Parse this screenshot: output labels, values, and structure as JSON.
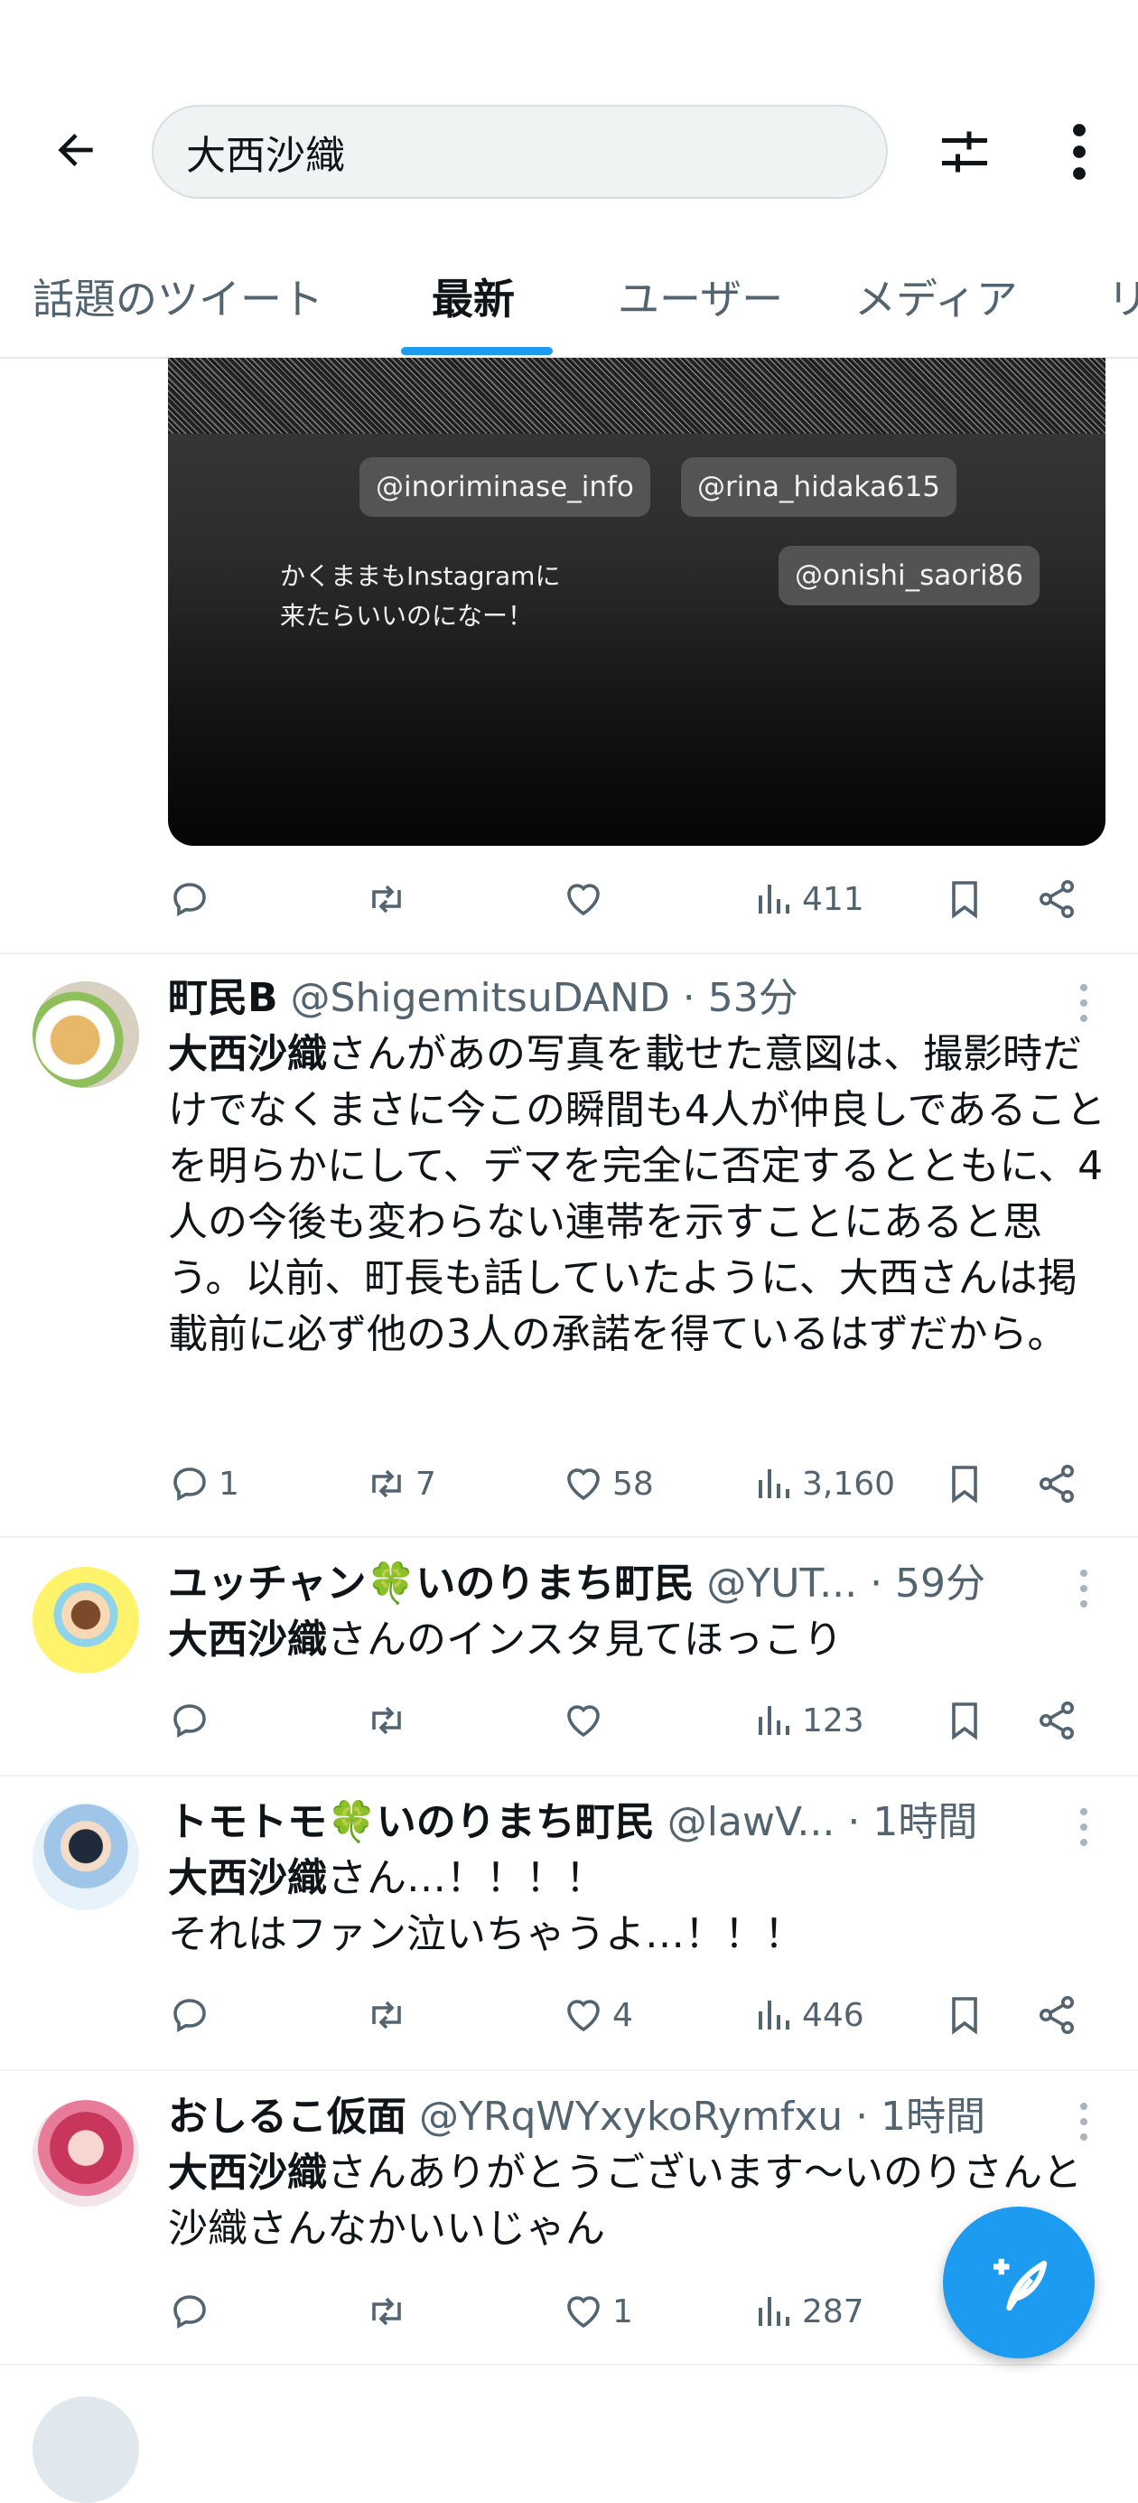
{
  "header": {
    "search_value": "大西沙織",
    "tabs": [
      {
        "label": "話題のツイート"
      },
      {
        "label": "最新"
      },
      {
        "label": "ユーザー"
      },
      {
        "label": "メディア"
      },
      {
        "label": "リ"
      }
    ],
    "active_tab": "最新"
  },
  "media": {
    "tags": [
      "@inoriminase_info",
      "@rina_hidaka615",
      "@onishi_saori86"
    ],
    "caption": "かくままもInstagramに\n来たらいいのになー！"
  },
  "top_actions": {
    "views": "411"
  },
  "tweets": [
    {
      "name": "町民B",
      "handle": "@ShigemitsuDAND",
      "time": "· 53分",
      "highlight": "大西沙織",
      "text_rest": "さんがあの写真を載せた意図は、撮影時だけでなくまさに今この瞬間も4人が仲良しであることを明らかにして、デマを完全に否定するとともに、4人の今後も変わらない連帯を示すことにあると思う。以前、町長も話していたように、大西さんは掲載前に必ず他の3人の承諾を得ているはずだから。",
      "replies": "1",
      "retweets": "7",
      "likes": "58",
      "views": "3,160"
    },
    {
      "name": "ユッチャン🍀いのりまち町民",
      "handle": "@YUT...",
      "time": "· 59分",
      "highlight": "大西沙織",
      "text_rest": "さんのインスタ見てほっこり",
      "replies": "",
      "retweets": "",
      "likes": "",
      "views": "123"
    },
    {
      "name": "トモトモ🍀いのりまち町民",
      "handle": "@lawV...",
      "time": "· 1時間",
      "highlight": "大西沙織",
      "text_rest": "さん…！！！！\nそれはファン泣いちゃうよ…！！！",
      "replies": "",
      "retweets": "",
      "likes": "4",
      "views": "446"
    },
    {
      "name": "おしるこ仮面",
      "handle": "@YRqWYxykoRymfxu",
      "time": "· 1時間",
      "highlight": "大西沙織",
      "text_rest": "さんありがとうございます〜いのりさんと沙織さんなかいいじゃん",
      "replies": "",
      "retweets": "",
      "likes": "1",
      "views": "287"
    }
  ],
  "colors": {
    "accent": "#1d9bf0",
    "text": "#0f1419",
    "muted": "#536471"
  }
}
